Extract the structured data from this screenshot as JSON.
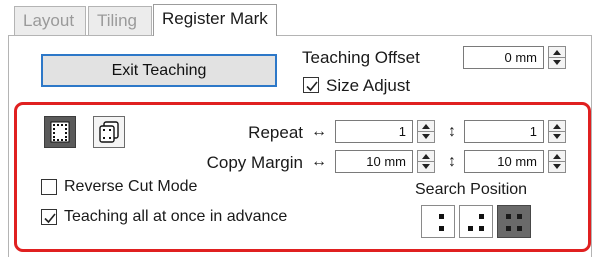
{
  "tabs": [
    {
      "label": "Layout",
      "active": false
    },
    {
      "label": "Tiling",
      "active": false
    },
    {
      "label": "Register Mark",
      "active": true
    }
  ],
  "exit_button": {
    "label": "Exit Teaching"
  },
  "teaching_offset": {
    "label": "Teaching Offset",
    "value": "0 mm"
  },
  "size_adjust": {
    "label": "Size Adjust",
    "checked": true
  },
  "mode_buttons": [
    {
      "icon": "register-mark-grid-icon",
      "active": true
    },
    {
      "icon": "copy-pages-icon",
      "active": false
    }
  ],
  "repeat": {
    "label": "Repeat",
    "horizontal_symbol": "↔",
    "vertical_symbol": "↕",
    "horizontal": "1",
    "vertical": "1"
  },
  "copy_margin": {
    "label": "Copy Margin",
    "horizontal_symbol": "↔",
    "vertical_symbol": "↕",
    "horizontal": "10 mm",
    "vertical": "10 mm"
  },
  "reverse_cut_mode": {
    "label": "Reverse Cut Mode",
    "checked": false
  },
  "teaching_all": {
    "label": "Teaching all at once in advance",
    "checked": true
  },
  "search_position": {
    "label": "Search Position",
    "options": [
      {
        "icon": "two-points-icon",
        "selected": false
      },
      {
        "icon": "three-points-icon",
        "selected": false
      },
      {
        "icon": "four-points-icon",
        "selected": true
      }
    ]
  },
  "colors": {
    "highlight": "#e02020",
    "accent_border": "#2d78c8",
    "active_button": "#5a5a5a"
  }
}
